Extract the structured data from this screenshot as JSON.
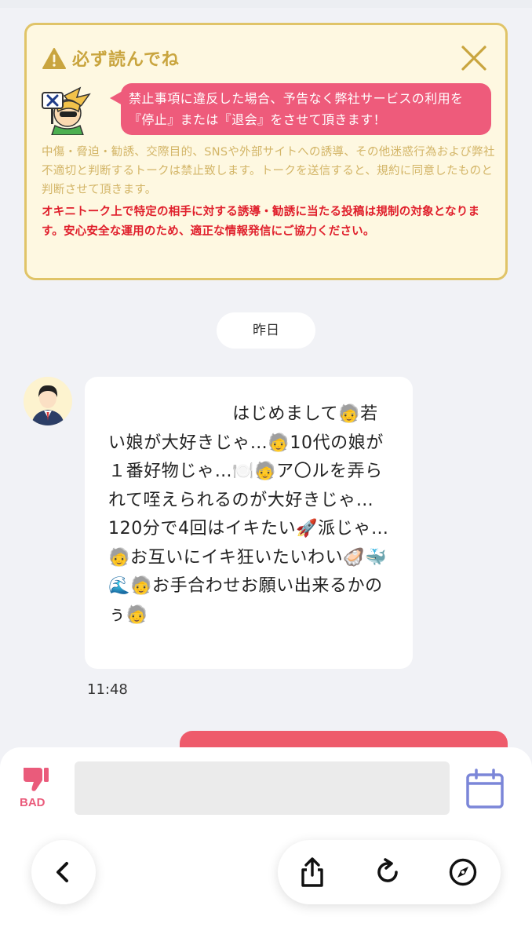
{
  "notice": {
    "title": "必ず読んでね",
    "speech": "禁止事項に違反した場合、予告なく弊社サービスの利用を『停止』または『退会』をさせて頂きます！",
    "body": "中傷・脅迫・勧誘、交際目的、SNSや外部サイトへの誘導、その他迷惑行為および弊社不適切と判断するトークは禁止致します。トークを送信すると、規約に同意したものと判断させて頂きます。",
    "warning": "オキニトーク上で特定の相手に対する誘導・勧誘に当たる投稿は規制の対象となります。安心安全な運用のため、適正な情報発信にご協力ください。",
    "icons": [
      "warning-icon",
      "close-icon",
      "mascot-icon"
    ]
  },
  "chat": {
    "date_label": "昨日",
    "message": {
      "text": "　　　　　　　はじめまして🧓若い娘が大好きじゃ…🧓10代の娘が１番好物じゃ…🍽️🧓ア〇ルを弄られて咥えられるのが大好きじゃ…120分で4回はイキたい🚀派じゃ…🧓お互いにイキ狂いたいわい🦪🐳🌊🧓お手合わせお願い出来るかのぅ🧓",
      "time": "11:48"
    }
  },
  "composer": {
    "bad_label": "BAD",
    "input_value": "",
    "icons": [
      "thumbs-down-icon",
      "calendar-icon"
    ]
  },
  "nav": {
    "icons": [
      "back-icon",
      "share-icon",
      "reload-icon",
      "compass-icon"
    ]
  },
  "colors": {
    "accent_pink": "#ee5b7b",
    "notice_gold": "#e0c468",
    "warning_red": "#e0202c",
    "calendar_blue": "#7b86d8"
  }
}
